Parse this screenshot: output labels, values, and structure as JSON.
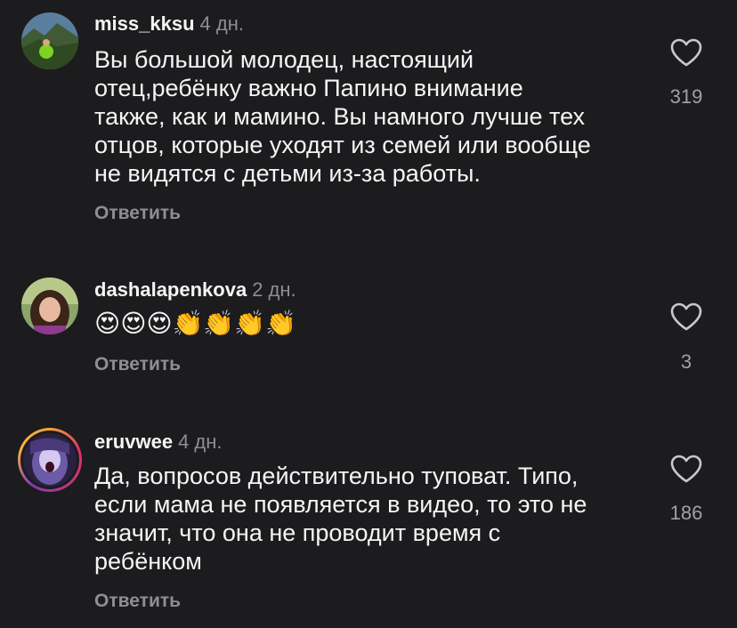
{
  "comments": [
    {
      "username": "miss_kksu",
      "time": "4 дн.",
      "text": "Вы большой молодец, настоящий\nотец,ребёнку важно Папино внимание\nтакже, как и мамино. Вы намного лучше тех\nотцов, которые уходят из семей или вообще\nне видятся с детьми из-за работы.",
      "reply_label": "Ответить",
      "like_count": "319",
      "avatar_icon": "landscape-avatar-icon"
    },
    {
      "username": "dashalapenkova",
      "time": "2 дн.",
      "text": "😍😍😍👏👏👏👏",
      "reply_label": "Ответить",
      "like_count": "3",
      "avatar_icon": "portrait-avatar-icon"
    },
    {
      "username": "eruvwee",
      "time": "4 дн.",
      "text": "Да, вопросов действительно туповат. Типо,\nесли мама не появляется в видео, то это не\nзначит, что она не проводит время с\nребёнком",
      "reply_label": "Ответить",
      "like_count": "186",
      "avatar_icon": "story-ring-avatar-icon"
    }
  ],
  "icons": {
    "like": "heart-outline-icon"
  },
  "colors": {
    "background": "#1c1c1e",
    "text": "#f5f5f5",
    "secondary": "#8e8e93"
  }
}
